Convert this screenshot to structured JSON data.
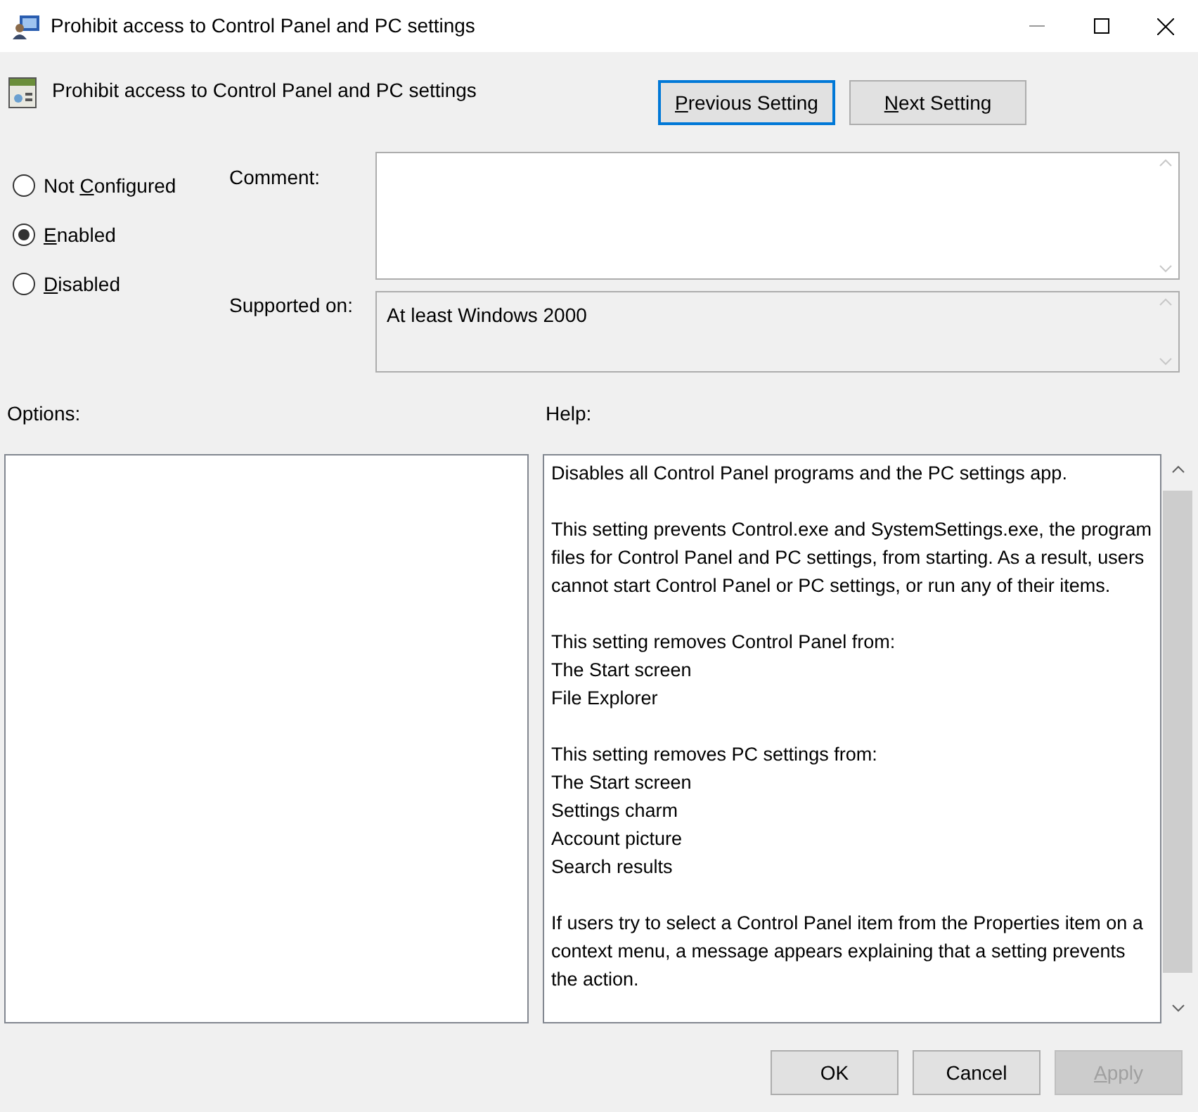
{
  "window": {
    "title": "Prohibit access to Control Panel and PC settings"
  },
  "header": {
    "title": "Prohibit access to Control Panel and PC settings"
  },
  "nav_buttons": [
    {
      "access_key": "P",
      "label_post": "revious Setting",
      "focused": true
    },
    {
      "access_key": "N",
      "label_post": "ext Setting",
      "focused": false
    }
  ],
  "state_options": [
    {
      "label_pre": "Not ",
      "access_key": "C",
      "label_post": "onfigured",
      "selected": false
    },
    {
      "access_key": "E",
      "label_post": "nabled",
      "selected": true
    },
    {
      "access_key": "D",
      "label_post": "isabled",
      "selected": false
    }
  ],
  "comment": {
    "label": "Comment:"
  },
  "supported_on": {
    "label": "Supported on:",
    "value": "At least Windows 2000"
  },
  "options": {
    "label": "Options:"
  },
  "help": {
    "label": "Help:",
    "paragraphs": [
      [
        "Disables all Control Panel programs and the PC settings app."
      ],
      [
        "This setting prevents Control.exe and SystemSettings.exe, the program files for Control Panel and PC settings, from starting. As a result, users cannot start Control Panel or PC settings, or run any of their items."
      ],
      [
        "This setting removes Control Panel from:",
        "The Start screen",
        "File Explorer"
      ],
      [
        "This setting removes PC settings from:",
        "The Start screen",
        "Settings charm",
        "Account picture",
        "Search results"
      ],
      [
        "If users try to select a Control Panel item from the Properties item on a context menu, a message appears explaining that a setting prevents the action."
      ]
    ]
  },
  "footer_buttons": [
    {
      "label_pre": "OK",
      "disabled": false
    },
    {
      "label_pre": "Cancel",
      "disabled": false
    },
    {
      "access_key": "A",
      "label_post": "pply",
      "disabled": true
    }
  ]
}
